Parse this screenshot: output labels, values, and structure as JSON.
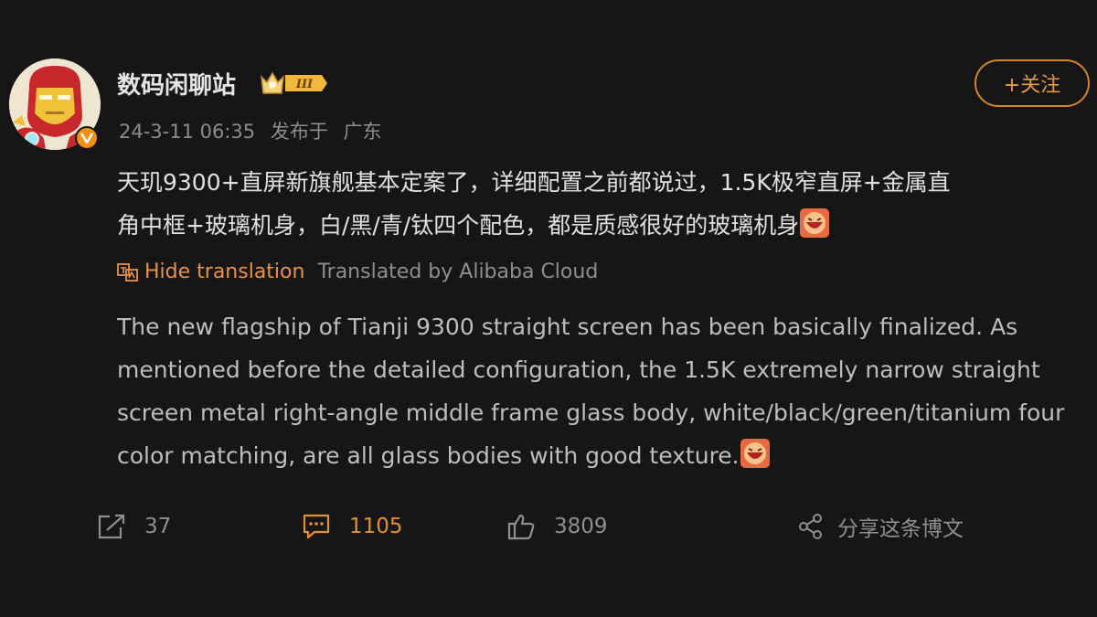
{
  "post": {
    "author": {
      "name": "数码闲聊站",
      "badge_text": "III"
    },
    "meta": {
      "timestamp": "24-3-11 06:35",
      "publish_label": "发布于",
      "location": "广东"
    },
    "follow_label": "+关注",
    "content": {
      "line1": "天玑9300+直屏新旗舰基本定案了，详细配置之前都说过，1.5K极窄直屏+金属直",
      "line2": "角中框+玻璃机身，白/黑/青/钛四个配色，都是质感很好的玻璃机身"
    },
    "translation": {
      "hide_label": "Hide translation",
      "provider_label": "Translated by Alibaba Cloud",
      "text": "The new flagship of Tianji 9300 straight screen has been basically finalized. As mentioned before the detailed configuration, the 1.5K extremely narrow straight screen metal right-angle middle frame glass body, white/black/green/titanium four color matching, are all glass bodies with good texture."
    },
    "actions": {
      "forward_count": "37",
      "comment_count": "1105",
      "like_count": "3809",
      "share_label": "分享这条博文"
    },
    "colors": {
      "accent": "#e8914a",
      "background": "#161616",
      "muted": "#8e8e8e"
    }
  }
}
